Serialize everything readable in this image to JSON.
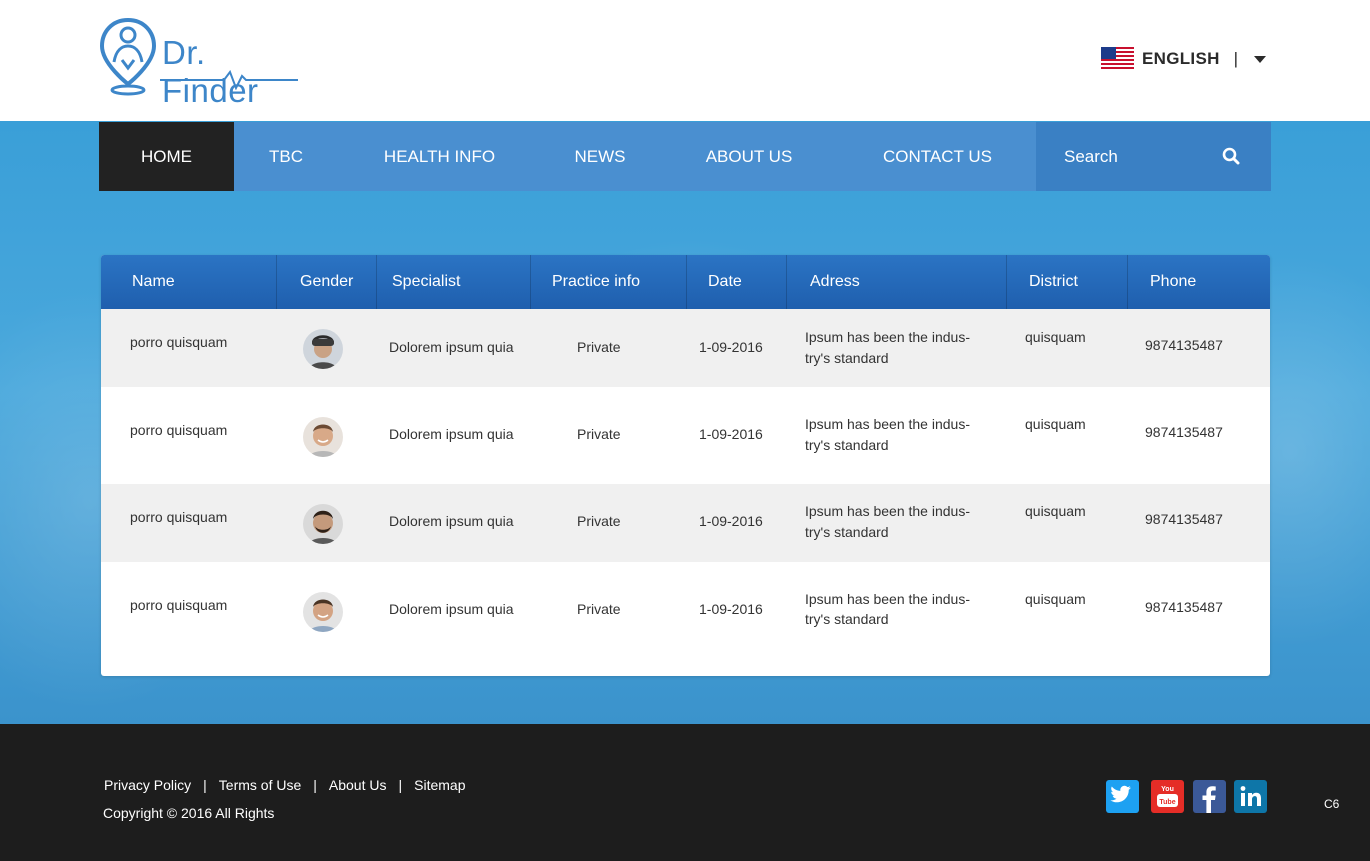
{
  "header": {
    "logo_text": "Dr. Finder",
    "language": "ENGLISH",
    "language_separator": "|"
  },
  "nav": {
    "items": [
      {
        "label": "HOME",
        "active": true
      },
      {
        "label": "TBC"
      },
      {
        "label": "HEALTH INFO"
      },
      {
        "label": "NEWS"
      },
      {
        "label": "ABOUT US"
      },
      {
        "label": "CONTACT US"
      }
    ],
    "search_placeholder": "Search"
  },
  "table": {
    "columns": [
      "Name",
      "Gender",
      "Specialist",
      "Practice info",
      "Date",
      "Adress",
      "District",
      "Phone"
    ],
    "rows": [
      {
        "name": "porro quisquam",
        "specialist": "Dolorem ipsum quia",
        "practice": "Private",
        "date": "1-09-2016",
        "address_line1": "Ipsum has been the indus-",
        "address_line2": "try's standard",
        "district": "quisquam",
        "phone": "9874135487"
      },
      {
        "name": "porro quisquam",
        "specialist": "Dolorem ipsum quia",
        "practice": "Private",
        "date": "1-09-2016",
        "address_line1": "Ipsum has been the indus-",
        "address_line2": "try's standard",
        "district": "quisquam",
        "phone": "9874135487"
      },
      {
        "name": "porro quisquam",
        "specialist": "Dolorem ipsum quia",
        "practice": "Private",
        "date": "1-09-2016",
        "address_line1": "Ipsum has been the indus-",
        "address_line2": "try's standard",
        "district": "quisquam",
        "phone": "9874135487"
      },
      {
        "name": "porro quisquam",
        "specialist": "Dolorem ipsum quia",
        "practice": "Private",
        "date": "1-09-2016",
        "address_line1": "Ipsum has been the indus-",
        "address_line2": "try's standard",
        "district": "quisquam",
        "phone": "9874135487"
      }
    ]
  },
  "footer": {
    "links": [
      "Privacy Policy",
      "Terms of Use",
      "About Us",
      "Sitemap"
    ],
    "separator": "|",
    "copyright": "Copyright © 2016  All Rights",
    "code": "C6",
    "social": [
      {
        "icon": "twitter-icon",
        "color": "#1da1f2"
      },
      {
        "icon": "youtube-icon",
        "color": "#e52d27"
      },
      {
        "icon": "facebook-icon",
        "color": "#3b5998"
      },
      {
        "icon": "linkedin-icon",
        "color": "#0e76a8"
      }
    ]
  },
  "colors": {
    "brand": "#3d86c9",
    "nav": "#4a8fd0",
    "nav_active": "#222222",
    "table_header": "#2468b8",
    "footer": "#1d1d1d"
  }
}
